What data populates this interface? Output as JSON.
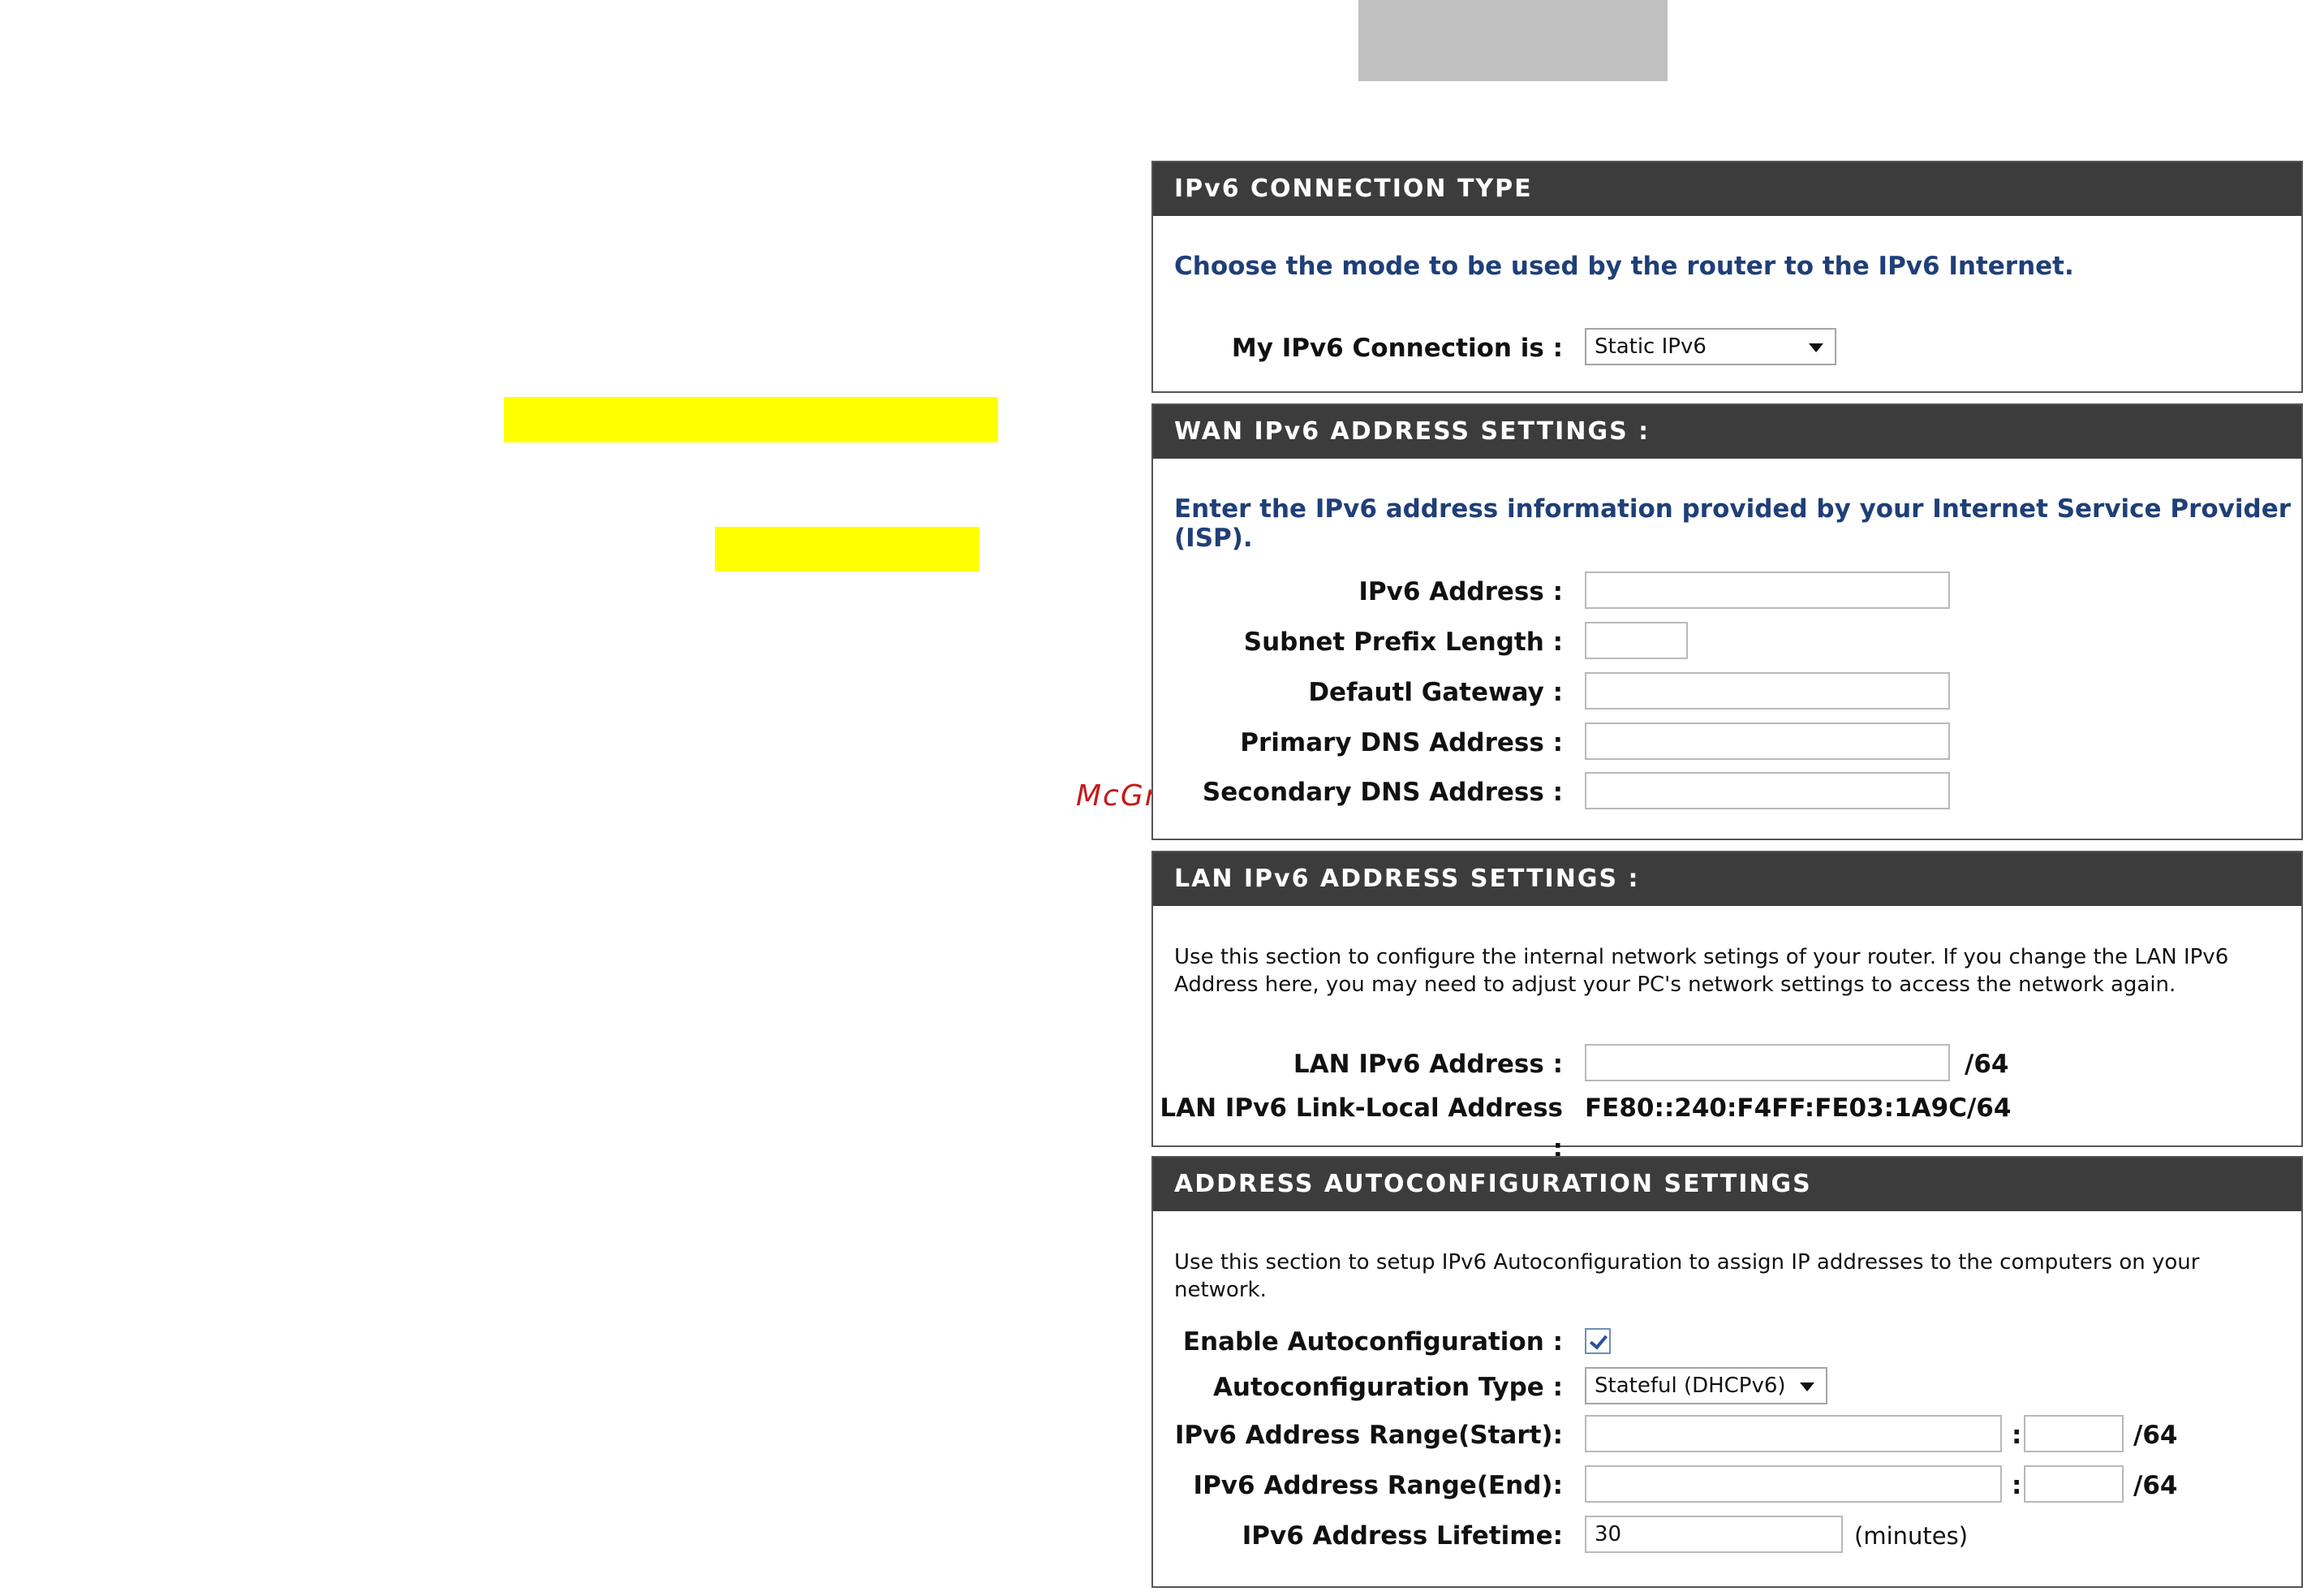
{
  "watermark": "McGrp.Ru",
  "connection_type": {
    "header": "IPv6 CONNECTION TYPE",
    "intro": "Choose the mode to be used by the router to the IPv6 Internet.",
    "label": "My IPv6 Connection is :",
    "value": "Static IPv6"
  },
  "wan": {
    "header": "WAN IPv6 ADDRESS SETTINGS :",
    "intro": "Enter the IPv6 address information provided by your Internet Service Provider (ISP).",
    "ipv6_address_label": "IPv6 Address :",
    "ipv6_address_value": "",
    "subnet_prefix_label": "Subnet Prefix Length :",
    "subnet_prefix_value": "",
    "gateway_label": "Defautl Gateway :",
    "gateway_value": "",
    "primary_dns_label": "Primary DNS Address :",
    "primary_dns_value": "",
    "secondary_dns_label": "Secondary DNS Address :",
    "secondary_dns_value": ""
  },
  "lan": {
    "header": "LAN IPv6 ADDRESS SETTINGS :",
    "intro": "Use this section to configure the internal network setings of your router. If you change the LAN IPv6 Address here, you may need to adjust your PC's network settings to access the network again.",
    "lan_address_label": "LAN IPv6 Address :",
    "lan_address_value": "",
    "lan_address_suffix": "/64",
    "link_local_label": "LAN IPv6 Link-Local Address :",
    "link_local_value": "FE80::240:F4FF:FE03:1A9C/64"
  },
  "autoconfig": {
    "header": "ADDRESS AUTOCONFIGURATION SETTINGS",
    "intro": "Use this section to setup IPv6 Autoconfiguration to assign IP addresses to the computers on your network.",
    "enable_label": "Enable Autoconfiguration :",
    "enable_checked": true,
    "type_label": "Autoconfiguration Type :",
    "type_value": "Stateful (DHCPv6)",
    "range_start_label": "IPv6 Address Range(Start):",
    "range_start_value": "",
    "range_start_suffix_value": "",
    "range_end_label": "IPv6 Address Range(End):",
    "range_end_value": "",
    "range_end_suffix_value": "",
    "separator": ":",
    "prefix_suffix": "/64",
    "lifetime_label": "IPv6 Address Lifetime:",
    "lifetime_value": "30",
    "lifetime_unit": "(minutes)"
  }
}
